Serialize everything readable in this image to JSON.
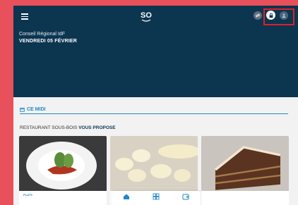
{
  "header": {
    "organization": "Conseil Régional IdF",
    "date": "VENDREDI 05 FÉVRIER",
    "logo_text": "SO"
  },
  "section": {
    "title": "CE MIDI",
    "restaurant": "RESTAURANT SOUS-BOIS",
    "proposes": "VOUS PROPOSE"
  },
  "cards": [
    {
      "category": "PLATS"
    },
    {
      "category": ""
    },
    {
      "category": ""
    }
  ],
  "tabbar": {
    "items": [
      {
        "icon": "home-icon",
        "label": ""
      },
      {
        "icon": "grid-icon",
        "label": ""
      },
      {
        "icon": "wallet-icon",
        "label": ""
      }
    ]
  },
  "colors": {
    "header_bg": "#0c3550",
    "accent": "#1e88c7",
    "frame": "#e8505b",
    "highlight": "#e0202a"
  }
}
